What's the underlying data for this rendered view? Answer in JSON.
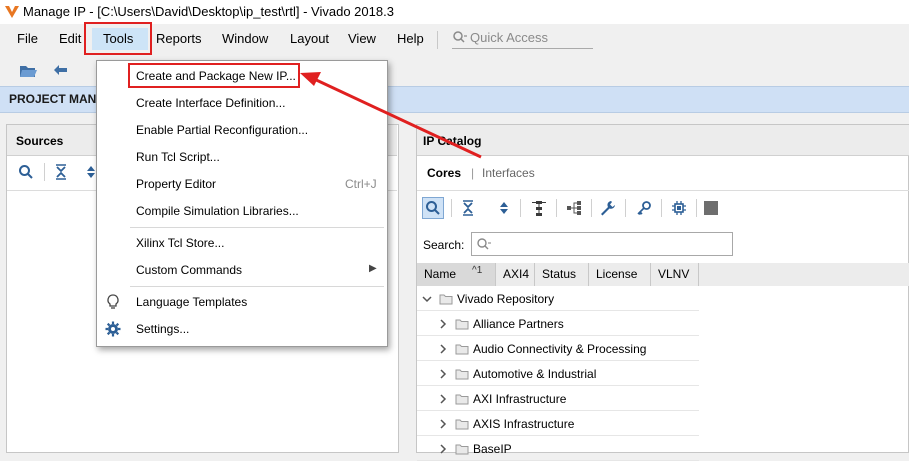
{
  "window": {
    "title": "Manage IP - [C:\\Users\\David\\Desktop\\ip_test\\rtl] - Vivado 2018.3"
  },
  "menubar": {
    "items": [
      "File",
      "Edit",
      "Tools",
      "Reports",
      "Window",
      "Layout",
      "View",
      "Help"
    ],
    "quick_access_placeholder": "Quick Access"
  },
  "flow": {
    "title": "PROJECT MANA"
  },
  "sources": {
    "title": "Sources"
  },
  "ip_catalog": {
    "title": "IP Catalog",
    "tabs": [
      "Cores",
      "Interfaces"
    ],
    "search_label": "Search:",
    "search_placeholder": "Q-",
    "columns": [
      "Name",
      "AXI4",
      "Status",
      "License",
      "VLNV"
    ],
    "sort_indicator": "^1",
    "tree": [
      {
        "label": "Vivado Repository",
        "expanded": true,
        "level": 0
      },
      {
        "label": "Alliance Partners",
        "expanded": false,
        "level": 1
      },
      {
        "label": "Audio Connectivity & Processing",
        "expanded": false,
        "level": 1
      },
      {
        "label": "Automotive & Industrial",
        "expanded": false,
        "level": 1
      },
      {
        "label": "AXI Infrastructure",
        "expanded": false,
        "level": 1
      },
      {
        "label": "AXIS Infrastructure",
        "expanded": false,
        "level": 1
      },
      {
        "label": "BaseIP",
        "expanded": false,
        "level": 1
      }
    ]
  },
  "tools_menu": {
    "items": [
      {
        "label": "Create and Package New IP...",
        "highlighted": true
      },
      {
        "label": "Create Interface Definition..."
      },
      {
        "label": "Enable Partial Reconfiguration..."
      },
      {
        "label": "Run Tcl Script..."
      },
      {
        "label": "Property Editor",
        "shortcut": "Ctrl+J"
      },
      {
        "label": "Compile Simulation Libraries..."
      },
      {
        "label": "Xilinx Tcl Store..."
      },
      {
        "label": "Custom Commands",
        "submenu": true
      },
      {
        "label": "Language Templates",
        "icon": "lightbulb-icon"
      },
      {
        "label": "Settings...",
        "icon": "gear-icon"
      }
    ]
  },
  "colors": {
    "annotation_red": "#e02020",
    "flow_banner": "#cfe0f5",
    "menu_hover": "#cde4f7"
  }
}
